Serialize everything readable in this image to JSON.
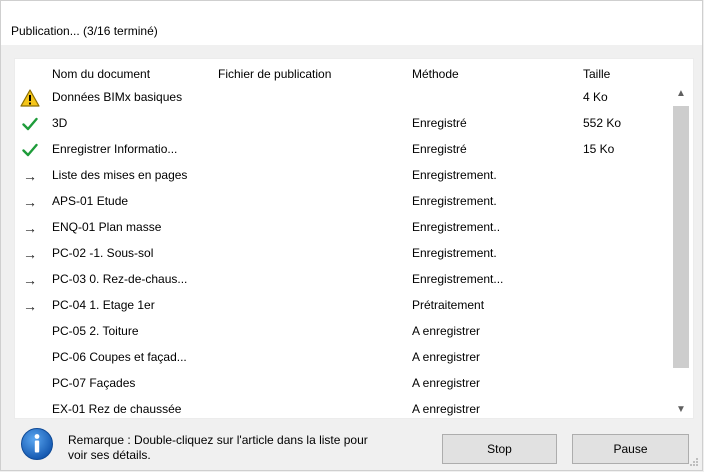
{
  "window": {
    "title": "Publication... (3/16 terminé)"
  },
  "columns": {
    "name": "Nom du document",
    "file": "Fichier de publication",
    "method": "Méthode",
    "size": "Taille"
  },
  "rows": [
    {
      "status": "warning-icon",
      "name": "Données BIMx basiques",
      "method": "",
      "size": "4 Ko"
    },
    {
      "status": "checkmark-icon",
      "name": "3D",
      "method": "Enregistré",
      "size": "552 Ko"
    },
    {
      "status": "checkmark-icon",
      "name": "Enregistrer Informatio...",
      "method": "Enregistré",
      "size": "15 Ko"
    },
    {
      "status": "arrow-right-icon",
      "name": "Liste des mises en pages",
      "method": "Enregistrement.",
      "size": ""
    },
    {
      "status": "arrow-right-icon",
      "name": "APS-01 Etude",
      "method": "Enregistrement.",
      "size": ""
    },
    {
      "status": "arrow-right-icon",
      "name": "ENQ-01 Plan masse",
      "method": "Enregistrement..",
      "size": ""
    },
    {
      "status": "arrow-right-icon",
      "name": "PC-02 -1. Sous-sol",
      "method": "Enregistrement.",
      "size": ""
    },
    {
      "status": "arrow-right-icon",
      "name": "PC-03 0. Rez-de-chaus...",
      "method": "Enregistrement...",
      "size": ""
    },
    {
      "status": "arrow-right-icon",
      "name": "PC-04 1. Etage 1er",
      "method": "Prétraitement",
      "size": ""
    },
    {
      "status": "",
      "name": "PC-05 2. Toiture",
      "method": "A enregistrer",
      "size": ""
    },
    {
      "status": "",
      "name": "PC-06 Coupes et façad...",
      "method": "A enregistrer",
      "size": ""
    },
    {
      "status": "",
      "name": "PC-07 Façades",
      "method": "A enregistrer",
      "size": ""
    },
    {
      "status": "",
      "name": "EX-01 Rez de chaussée",
      "method": "A enregistrer",
      "size": ""
    }
  ],
  "footer": {
    "note": "Remarque : Double-cliquez sur l'article dans la liste pour voir ses détails.",
    "stop_label": "Stop",
    "pause_label": "Pause"
  },
  "colors": {
    "check": "#1e9c3a",
    "info": "#1b6fc9",
    "warning": "#f5c518"
  }
}
